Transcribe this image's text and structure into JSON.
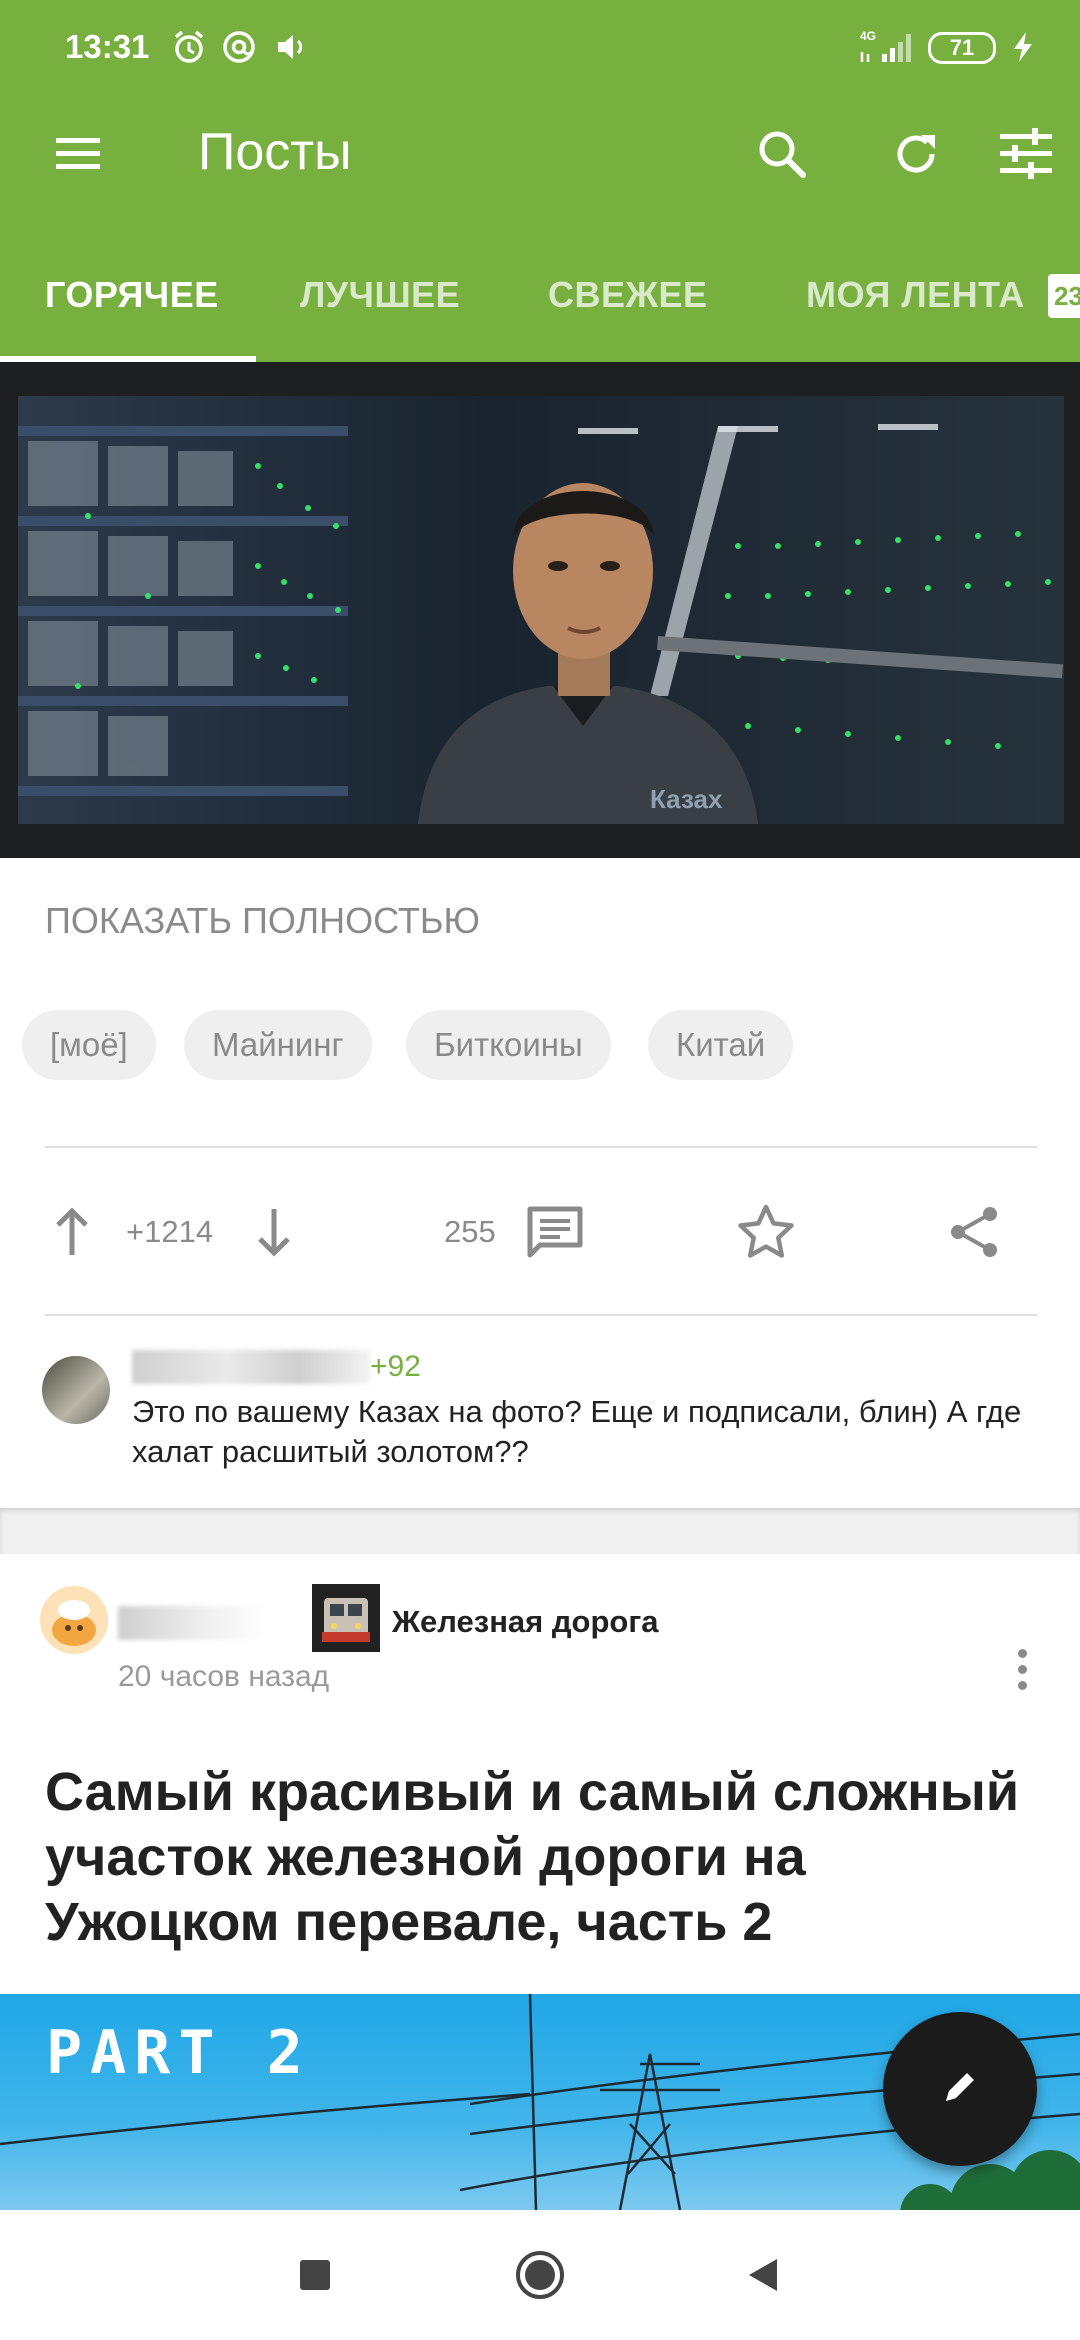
{
  "status_bar": {
    "time": "13:31",
    "network": "4G",
    "battery": "71",
    "icons": [
      "alarm-icon",
      "at-icon",
      "volume-icon",
      "signal-icon",
      "battery-icon",
      "charging-icon"
    ]
  },
  "toolbar": {
    "title": "Посты",
    "icons": [
      "menu-icon",
      "search-icon",
      "refresh-icon",
      "filter-icon"
    ]
  },
  "tabs": {
    "items": [
      "ГОРЯЧЕЕ",
      "ЛУЧШЕЕ",
      "СВЕЖЕЕ",
      "МОЯ ЛЕНТА"
    ],
    "selected": 0,
    "badge": "23"
  },
  "post1": {
    "image_caption": "Казах",
    "show_full_label": "ПОКАЗАТЬ ПОЛНОСТЬЮ",
    "tags": [
      "[моё]",
      "Майнинг",
      "Биткоины",
      "Китай"
    ],
    "rating": "+1214",
    "comments_count": "255",
    "top_comment": {
      "score": "+92",
      "text": "Это по вашему Казах на фото? Еще и подписали, блин) А где халат расшитый золотом??"
    }
  },
  "post2": {
    "community": "Железная дорога",
    "time": "20 часов назад",
    "title": "Самый красивый и самый сложный участок железной дороги на Ужоцком перевале, часть 2",
    "image_text": "PART 2"
  },
  "colors": {
    "brand_green": "#78b040",
    "fab": "#1b1b1b",
    "muted_text": "#8a8a8a"
  },
  "navbar": {
    "icons": [
      "recents-icon",
      "home-icon",
      "back-icon"
    ]
  }
}
